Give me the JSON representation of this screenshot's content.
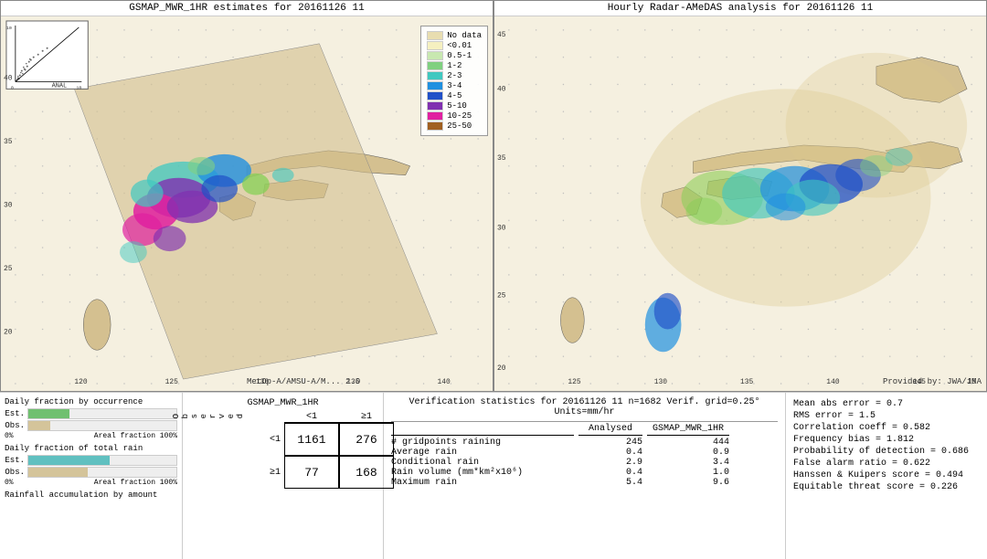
{
  "left_map": {
    "title": "GSMAP_MWR_1HR estimates for 20161126 11",
    "credit": "MetOp-A/AMSU-A/M... 2.0"
  },
  "right_map": {
    "title": "Hourly Radar-AMeDAS analysis for 20161126 11",
    "credit": "Provided by: JWA/JMA"
  },
  "legend": {
    "items": [
      {
        "label": "No data",
        "color": "#e8ddb0"
      },
      {
        "label": "<0.01",
        "color": "#f5f0c0"
      },
      {
        "label": "0.5-1",
        "color": "#c8e8b0"
      },
      {
        "label": "1-2",
        "color": "#80d080"
      },
      {
        "label": "2-3",
        "color": "#40c8c0"
      },
      {
        "label": "3-4",
        "color": "#2090e0"
      },
      {
        "label": "4-5",
        "color": "#2050c8"
      },
      {
        "label": "5-10",
        "color": "#8030b0"
      },
      {
        "label": "10-25",
        "color": "#e020a0"
      },
      {
        "label": "25-50",
        "color": "#a06020"
      }
    ]
  },
  "bar_charts": {
    "section1_title": "Daily fraction by occurrence",
    "est_label": "Est.",
    "obs_label": "Obs.",
    "axis_left": "0%",
    "axis_right": "Areal fraction 100%",
    "section2_title": "Daily fraction of total rain",
    "est2_label": "Est.",
    "obs2_label": "Obs.",
    "section3_label": "Rainfall accumulation by amount"
  },
  "contingency": {
    "title": "GSMAP_MWR_1HR",
    "col1": "<1",
    "col2": "≥1",
    "obs_label": "O\nb\ns\ne\nr\nv\ne\nd",
    "row1_label": "<1",
    "row2_label": "≥1",
    "val_1161": "1161",
    "val_276": "276",
    "val_77": "77",
    "val_168": "168"
  },
  "stats": {
    "title": "Verification statistics for 20161126 11  n=1682  Verif. grid=0.25°  Units=mm/hr",
    "col_header1": "Analysed",
    "col_header2": "GSMAP_MWR_1HR",
    "rows": [
      {
        "label": "# gridpoints raining",
        "val1": "245",
        "val2": "444"
      },
      {
        "label": "Average rain",
        "val1": "0.4",
        "val2": "0.9"
      },
      {
        "label": "Conditional rain",
        "val1": "2.9",
        "val2": "3.4"
      },
      {
        "label": "Rain volume (mm*km²x10⁶)",
        "val1": "0.4",
        "val2": "1.0"
      },
      {
        "label": "Maximum rain",
        "val1": "5.4",
        "val2": "9.6"
      }
    ]
  },
  "scores": {
    "mean_abs_error": "Mean abs error = 0.7",
    "rms_error": "RMS error = 1.5",
    "corr_coeff": "Correlation coeff = 0.582",
    "freq_bias": "Frequency bias = 1.812",
    "prob_detection": "Probability of detection = 0.686",
    "false_alarm": "False alarm ratio = 0.622",
    "hanssen_kuipers": "Hanssen & Kuipers score = 0.494",
    "equitable_threat": "Equitable threat score = 0.226"
  }
}
